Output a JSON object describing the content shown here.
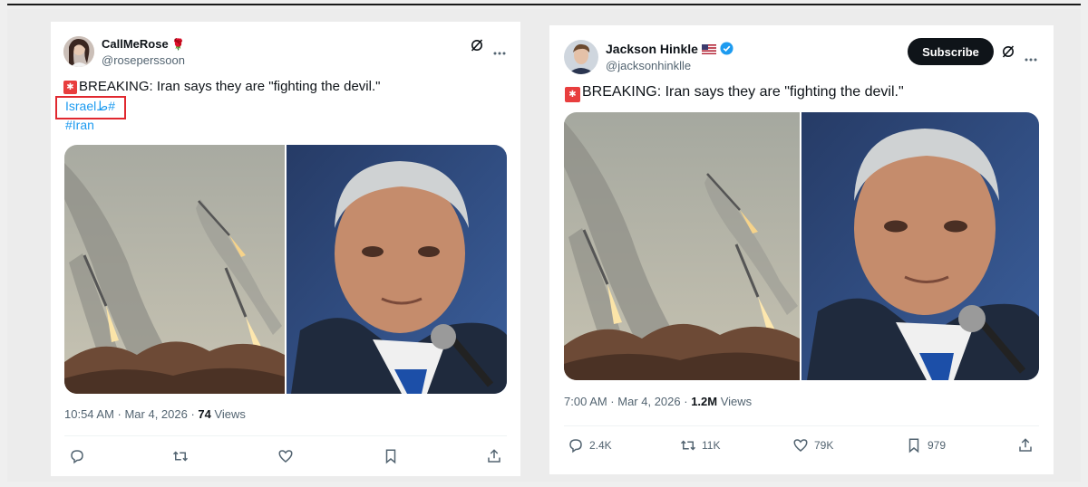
{
  "tweets": [
    {
      "display_name": "CallMeRose",
      "handle": "@roseperssoon",
      "text": "BREAKING: Iran says they are \"fighting the devil.\"",
      "hashtags": [
        "Israelط#",
        "#Iran"
      ],
      "timestamp": "10:54 AM · Mar 4, 2026 · ",
      "views_count": "74",
      "views_label": " Views",
      "actions": {
        "replies": "",
        "reposts": "",
        "likes": "",
        "bookmarks": ""
      }
    },
    {
      "display_name": "Jackson Hinkle",
      "handle": "@jacksonhinklle",
      "subscribe_label": "Subscribe",
      "text": "BREAKING: Iran says they are \"fighting the devil.\"",
      "timestamp": "7:00 AM · Mar 4, 2026 · ",
      "views_count": "1.2M",
      "views_label": " Views",
      "actions": {
        "replies": "2.4K",
        "reposts": "11K",
        "likes": "79K",
        "bookmarks": "979"
      }
    }
  ],
  "colors": {
    "link": "#1d9bf0",
    "highlight": "#e0282f",
    "verified": "#1d9bf0"
  }
}
